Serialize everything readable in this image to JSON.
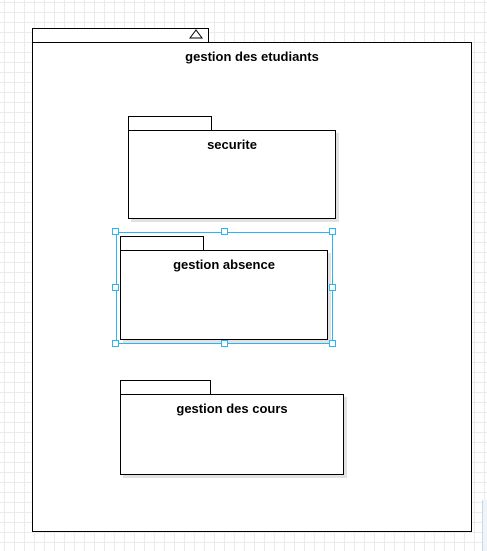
{
  "diagram": {
    "outer_package": {
      "title": "gestion des etudiants",
      "collapse_icon": "collapse-triangle-icon"
    },
    "packages": [
      {
        "id": "securite",
        "title": "securite",
        "selected": false
      },
      {
        "id": "gestion-absence",
        "title": "gestion absence",
        "selected": true
      },
      {
        "id": "gestion-des-cours",
        "title": "gestion des cours",
        "selected": false
      }
    ],
    "colors": {
      "selection": "#29b6f2",
      "border": "#000000",
      "grid": "#ebebeb"
    }
  }
}
